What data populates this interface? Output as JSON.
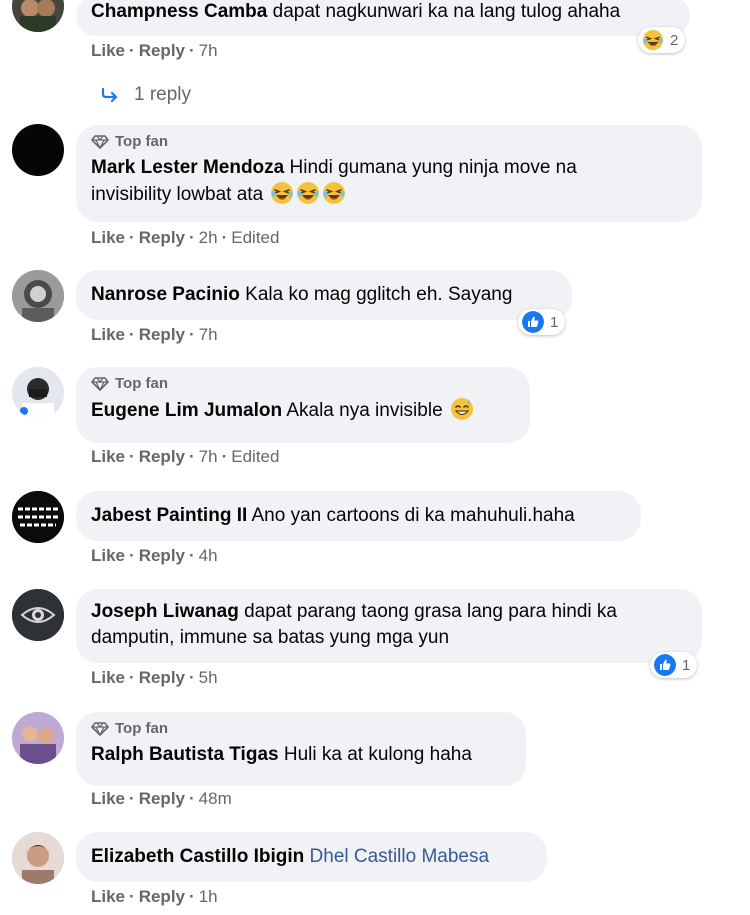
{
  "comments": [
    {
      "author": "Champness Camba",
      "text": "dapat nagkunwari ka na lang tulog ahaha",
      "top_fan": false,
      "actions": {
        "like": "Like",
        "reply": "Reply",
        "time": "7h"
      },
      "reaction": {
        "type": "haha",
        "count": "2"
      },
      "replies_label": "1 reply"
    },
    {
      "author": "Mark Lester Mendoza",
      "text_line1": "Hindi gumana yung ninja move na",
      "text_line2": "invisibility lowbat ata",
      "emoji_count": 3,
      "top_fan": true,
      "top_fan_label": "Top fan",
      "actions": {
        "like": "Like",
        "reply": "Reply",
        "time": "2h",
        "edited": "Edited"
      }
    },
    {
      "author": "Nanrose Pacinio",
      "text": "Kala ko mag gglitch eh. Sayang",
      "actions": {
        "like": "Like",
        "reply": "Reply",
        "time": "7h"
      },
      "reaction": {
        "type": "like",
        "count": "1"
      }
    },
    {
      "author": "Eugene Lim Jumalon",
      "text": "Akala nya invisible",
      "top_fan_label": "Top fan",
      "actions": {
        "like": "Like",
        "reply": "Reply",
        "time": "7h",
        "edited": "Edited"
      }
    },
    {
      "author": "Jabest Painting II",
      "text": "Ano yan cartoons di ka mahuhuli.haha",
      "actions": {
        "like": "Like",
        "reply": "Reply",
        "time": "4h"
      }
    },
    {
      "author": "Joseph Liwanag",
      "text_line1": "dapat parang taong grasa lang para hindi ka",
      "text_line2": "damputin, immune sa batas yung mga yun",
      "actions": {
        "like": "Like",
        "reply": "Reply",
        "time": "5h"
      },
      "reaction": {
        "type": "like",
        "count": "1"
      }
    },
    {
      "author": "Ralph Bautista Tigas",
      "text": "Huli ka at kulong haha",
      "top_fan_label": "Top fan",
      "actions": {
        "like": "Like",
        "reply": "Reply",
        "time": "48m"
      }
    },
    {
      "author": "Elizabeth Castillo Ibigin",
      "mention": "Dhel Castillo Mabesa",
      "actions": {
        "like": "Like",
        "reply": "Reply",
        "time": "1h"
      }
    }
  ],
  "colors": {
    "bubble_bg": "#f0f2f5",
    "secondary_text": "#65676b",
    "like_blue": "#1877f2",
    "mention_blue": "#385898"
  }
}
